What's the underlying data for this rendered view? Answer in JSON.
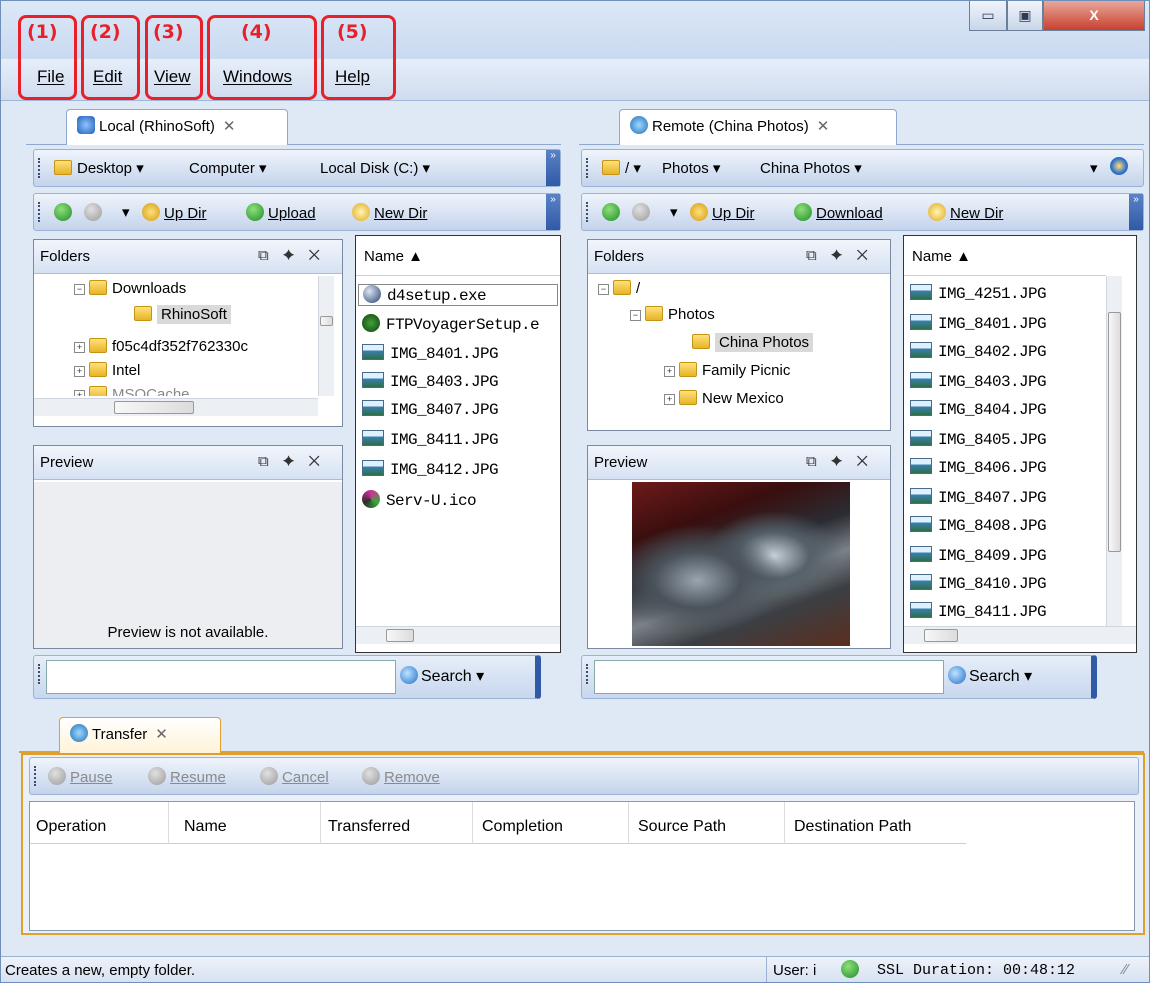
{
  "callouts": [
    "(1)",
    "(2)",
    "(3)",
    "(4)",
    "(5)"
  ],
  "window_controls": {
    "minimize": "▭",
    "maximize": "▣",
    "close": "X"
  },
  "menu": {
    "file": "File",
    "edit": "Edit",
    "view": "View",
    "windows": "Windows",
    "help": "Help"
  },
  "local": {
    "tab": "Local (RhinoSoft)",
    "path": [
      "Desktop",
      "Computer",
      "Local Disk (C:)"
    ],
    "toolbar": {
      "up_dir": "Up Dir",
      "upload": "Upload",
      "new_dir": "New Dir"
    },
    "folders_title": "Folders",
    "tree": [
      "Downloads",
      "RhinoSoft",
      "f05c4df352f762330c",
      "Intel",
      "MSOCache"
    ],
    "preview_title": "Preview",
    "preview_text": "Preview is not available.",
    "list_header": "Name ▲",
    "files": [
      "d4setup.exe",
      "FTPVoyagerSetup.e",
      "IMG_8401.JPG",
      "IMG_8403.JPG",
      "IMG_8407.JPG",
      "IMG_8411.JPG",
      "IMG_8412.JPG",
      "Serv-U.ico"
    ],
    "search_label": "Search"
  },
  "remote": {
    "tab": "Remote (China Photos)",
    "path": [
      "/",
      "Photos",
      "China Photos"
    ],
    "toolbar": {
      "up_dir": "Up Dir",
      "download": "Download",
      "new_dir": "New Dir"
    },
    "folders_title": "Folders",
    "tree": [
      "/",
      "Photos",
      "China Photos",
      "Family Picnic",
      "New Mexico"
    ],
    "preview_title": "Preview",
    "list_header": "Name ▲",
    "files": [
      "IMG_4251.JPG",
      "IMG_8401.JPG",
      "IMG_8402.JPG",
      "IMG_8403.JPG",
      "IMG_8404.JPG",
      "IMG_8405.JPG",
      "IMG_8406.JPG",
      "IMG_8407.JPG",
      "IMG_8408.JPG",
      "IMG_8409.JPG",
      "IMG_8410.JPG",
      "IMG_8411.JPG"
    ],
    "search_label": "Search"
  },
  "transfer": {
    "tab": "Transfer",
    "toolbar": {
      "pause": "Pause",
      "resume": "Resume",
      "cancel": "Cancel",
      "remove": "Remove"
    },
    "columns": [
      "Operation",
      "Name",
      "Transferred",
      "Completion",
      "Source Path",
      "Destination Path"
    ]
  },
  "status": {
    "message": "Creates a new, empty folder.",
    "user": "User: i",
    "ssl": "SSL Duration:  00:48:12"
  }
}
